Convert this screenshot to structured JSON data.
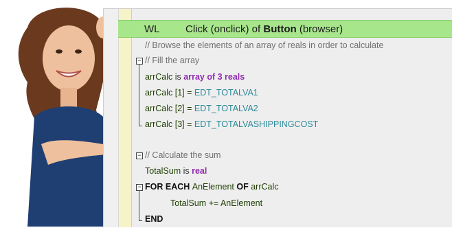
{
  "header": {
    "language": "WL",
    "event_prefix": "Click (onclick) of ",
    "control": "Button",
    "event_suffix": " (browser)"
  },
  "code": {
    "comment_browse": "// Browse the elements of an array of reals in order to calculate",
    "comment_fill": "// Fill the array",
    "decl_var": "arrCalc",
    "decl_is": " is ",
    "decl_type": "array of 3 reals",
    "assign1_var": "arrCalc [1] = ",
    "assign1_ctrl": "EDT_TOTALVA1",
    "assign2_var": "arrCalc [2] = ",
    "assign2_ctrl": "EDT_TOTALVA2",
    "assign3_var": "arrCalc [3] = ",
    "assign3_ctrl": "EDT_TOTALVASHIPPINGCOST",
    "comment_sum": "// Calculate the sum",
    "sum_var": "TotalSum",
    "sum_is": " is ",
    "sum_type": "real",
    "for_kw": "FOR EACH ",
    "for_elem": "AnElement",
    "for_of": " OF ",
    "for_arr": "arrCalc",
    "body_var": "TotalSum += AnElement",
    "end_kw": "END"
  },
  "colors": {
    "header_bg": "#a8e68c",
    "type_color": "#8f2bb0",
    "control_color": "#2c8a9a",
    "comment_color": "#707070"
  }
}
